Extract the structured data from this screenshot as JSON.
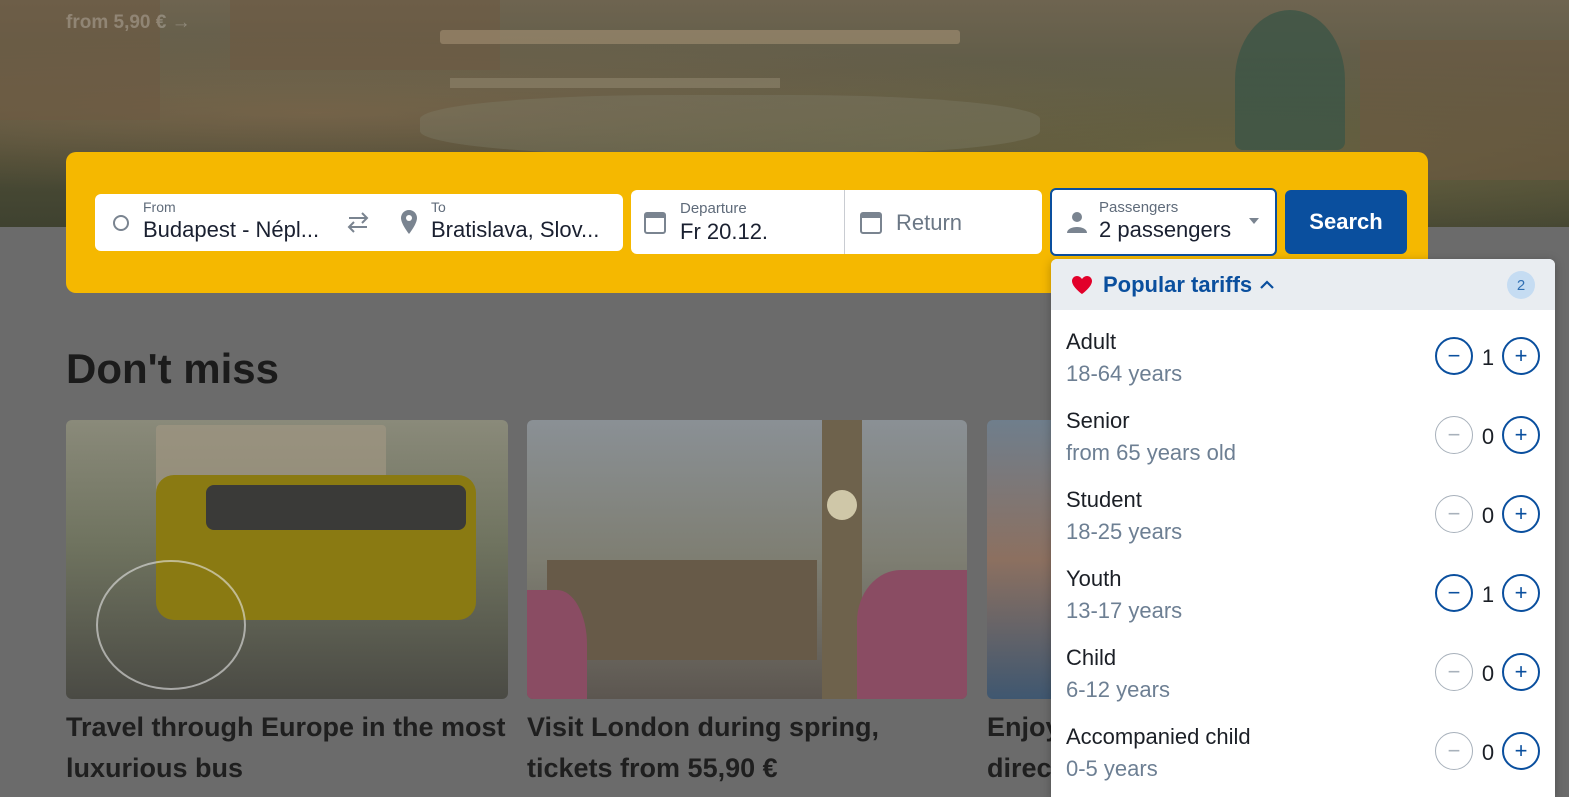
{
  "hero": {
    "promo_link": "from 5,90 € →"
  },
  "search": {
    "from_label": "From",
    "from_value": "Budapest - Népl...",
    "to_label": "To",
    "to_value": "Bratislava, Slov...",
    "departure_label": "Departure",
    "departure_value": "Fr 20.12.",
    "return_placeholder": "Return",
    "passengers_label": "Passengers",
    "passengers_value": "2 passengers",
    "search_button": "Search"
  },
  "dont_miss": {
    "title": "Don't miss",
    "cards": [
      {
        "title": "Travel through Europe in the most luxurious bus"
      },
      {
        "title": "Visit London during spring, tickets from 55,90 €"
      },
      {
        "title": "Enjoy direc"
      }
    ]
  },
  "passenger_dropdown": {
    "header_label": "Popular tariffs",
    "selected_count": "2",
    "tariffs": [
      {
        "name": "Adult",
        "range": "18-64 years",
        "count": "1",
        "minus": "−",
        "plus": "+"
      },
      {
        "name": "Senior",
        "range": "from 65 years old",
        "count": "0",
        "minus": "−",
        "plus": "+"
      },
      {
        "name": "Student",
        "range": "18-25 years",
        "count": "0",
        "minus": "−",
        "plus": "+"
      },
      {
        "name": "Youth",
        "range": "13-17 years",
        "count": "1",
        "minus": "−",
        "plus": "+"
      },
      {
        "name": "Child",
        "range": "6-12 years",
        "count": "0",
        "minus": "−",
        "plus": "+"
      },
      {
        "name": "Accompanied child",
        "range": "0-5 years",
        "count": "0",
        "minus": "−",
        "plus": "+"
      }
    ]
  },
  "colors": {
    "brand_yellow": "#f5b800",
    "brand_blue": "#0a4f9e",
    "heart_red": "#e2002a"
  }
}
